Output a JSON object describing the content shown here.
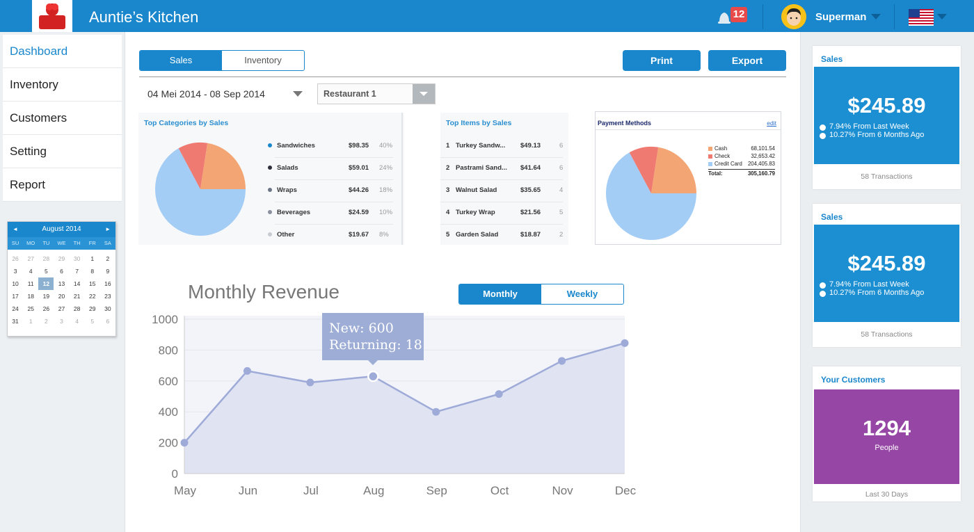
{
  "app": {
    "title": "Auntie’s Kitchen",
    "logo_text": "Auntie’s kitchen"
  },
  "header": {
    "notification_count": "12",
    "user_name": "Superman"
  },
  "sidebar": {
    "items": [
      {
        "label": "Dashboard",
        "active": true
      },
      {
        "label": "Inventory"
      },
      {
        "label": "Customers"
      },
      {
        "label": "Setting"
      },
      {
        "label": "Report"
      }
    ]
  },
  "calendar": {
    "month": "August 2014",
    "prev": "◄",
    "next": "►",
    "weekdays": [
      "SU",
      "MO",
      "TU",
      "WE",
      "TH",
      "FR",
      "SA"
    ],
    "days": [
      "26",
      "27",
      "28",
      "29",
      "30",
      "1",
      "2",
      "3",
      "4",
      "5",
      "6",
      "7",
      "8",
      "9",
      "10",
      "11",
      "12",
      "13",
      "14",
      "15",
      "16",
      "17",
      "18",
      "19",
      "20",
      "21",
      "22",
      "23",
      "24",
      "25",
      "26",
      "27",
      "28",
      "29",
      "30",
      "31",
      "1",
      "2",
      "3",
      "4",
      "5",
      "6"
    ],
    "selected": "12"
  },
  "toolbar": {
    "tabs": [
      "Sales",
      "Inventory"
    ],
    "print": "Print",
    "export": "Export",
    "date_range": "04 Mei 2014 - 08 Sep 2014",
    "restaurant": "Restaurant 1"
  },
  "top_categories": {
    "title": "Top Categories by Sales",
    "rows": [
      {
        "name": "Sandwiches",
        "value": "$98.35",
        "pct": "40%",
        "color": "#1a87cc"
      },
      {
        "name": "Salads",
        "value": "$59.01",
        "pct": "24%",
        "color": "#2c2f3a"
      },
      {
        "name": "Wraps",
        "value": "$44.26",
        "pct": "18%",
        "color": "#6c7486"
      },
      {
        "name": "Beverages",
        "value": "$24.59",
        "pct": "10%",
        "color": "#8a909d"
      },
      {
        "name": "Other",
        "value": "$19.67",
        "pct": "8%",
        "color": "#c7cbd2"
      }
    ]
  },
  "top_items": {
    "title": "Top Items by Sales",
    "rows": [
      {
        "rank": "1",
        "name": "Turkey Sandw...",
        "value": "$49.13",
        "qty": "6"
      },
      {
        "rank": "2",
        "name": "Pastrami Sand...",
        "value": "$41.64",
        "qty": "6"
      },
      {
        "rank": "3",
        "name": "Walnut Salad",
        "value": "$35.65",
        "qty": "4"
      },
      {
        "rank": "4",
        "name": "Turkey Wrap",
        "value": "$21.56",
        "qty": "5"
      },
      {
        "rank": "5",
        "name": "Garden Salad",
        "value": "$18.87",
        "qty": "2"
      }
    ]
  },
  "payment_methods": {
    "title": "Payment Methods",
    "edit": "edit",
    "rows": [
      {
        "name": "Cash",
        "value": "68,101.54",
        "color": "#f4a574"
      },
      {
        "name": "Check",
        "value": "32,653.42",
        "color": "#ee7a72"
      },
      {
        "name": "Credit Card",
        "value": "204,405.83",
        "color": "#a3cdf5"
      }
    ],
    "total_label": "Total:",
    "total_value": "305,160.79"
  },
  "revenue": {
    "title": "Monthly Revenue",
    "tabs": [
      "Monthly",
      "Weekly"
    ],
    "tooltip_line1": "New: 600",
    "tooltip_line2": "Returning: 18"
  },
  "chart_data": {
    "type": "area",
    "title": "Monthly Revenue",
    "categories": [
      "May",
      "Jun",
      "Jul",
      "Aug",
      "Sep",
      "Oct",
      "Nov",
      "Dec"
    ],
    "values": [
      200,
      665,
      590,
      630,
      400,
      515,
      730,
      845
    ],
    "ylim": [
      0,
      1000
    ],
    "yticks": [
      0,
      200,
      400,
      600,
      800,
      1000
    ],
    "grid": true,
    "highlight_index": 3
  },
  "cards": [
    {
      "title": "Sales",
      "amount": "$245.89",
      "line1": "7.94% From Last Week",
      "line2": "10.27% From 6 Months Ago",
      "foot": "58 Transactions",
      "color": "#1c8fd2"
    },
    {
      "title": "Sales",
      "amount": "$245.89",
      "line1": "7.94% From Last Week",
      "line2": "10.27% From 6 Months Ago",
      "foot": "58 Transactions",
      "color": "#1c8fd2"
    },
    {
      "title": "Your Customers",
      "amount": "1294",
      "line1": "People",
      "foot": "Last 30 Days",
      "color": "#9646a5"
    }
  ]
}
